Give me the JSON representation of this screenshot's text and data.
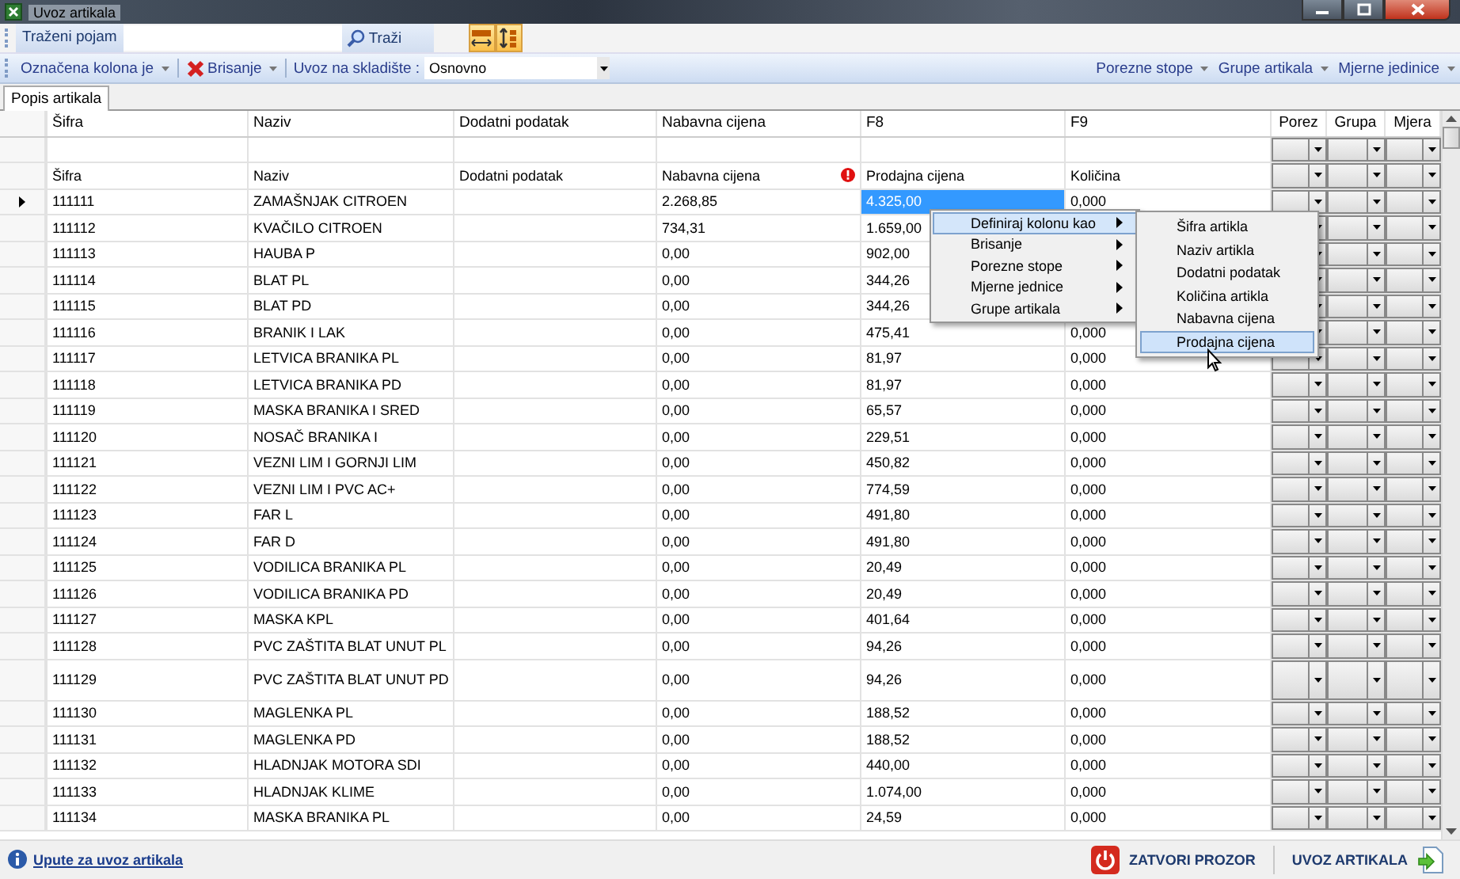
{
  "window": {
    "title": "Uvoz artikala"
  },
  "search_bar": {
    "label": "Traženi pojam",
    "button": "Traži"
  },
  "toolbar": {
    "left": [
      {
        "label": "Označena kolona je",
        "kind": "menu"
      },
      {
        "label": "Brisanje",
        "kind": "delete"
      }
    ],
    "warehouse_label": "Uvoz na skladište :",
    "warehouse_value": "Osnovno",
    "right": [
      "Porezne stope",
      "Grupe artikala",
      "Mjerne jedinice"
    ]
  },
  "tabs": [
    {
      "label": "Popis artikala",
      "selected": true
    }
  ],
  "table": {
    "columns": [
      "Šifra",
      "Naziv",
      "Dodatni podatak",
      "Nabavna cijena",
      "F8",
      "F9",
      "Porez",
      "Grupa",
      "Mjera"
    ],
    "mapping": [
      {
        "label": "Šifra",
        "error": false
      },
      {
        "label": "Naziv",
        "error": false
      },
      {
        "label": "Dodatni podatak",
        "error": false
      },
      {
        "label": "Nabavna cijena",
        "error": true
      },
      {
        "label": "Prodajna cijena",
        "error": false
      },
      {
        "label": "Količina",
        "error": false
      }
    ],
    "rows": [
      {
        "sifra": "111111",
        "naziv": "ZAMAŠNJAK CITROEN",
        "nabavna": "2.268,85",
        "prodajna": "4.325,00",
        "kolicina": "0,000",
        "selected": true
      },
      {
        "sifra": "111112",
        "naziv": "KVAČILO CITROEN",
        "nabavna": "734,31",
        "prodajna": "1.659,00",
        "selected": false
      },
      {
        "sifra": "111113",
        "naziv": "HAUBA P",
        "nabavna": "0,00",
        "prodajna": "902,00",
        "selected": false
      },
      {
        "sifra": "111114",
        "naziv": "BLAT PL",
        "nabavna": "0,00",
        "prodajna": "344,26",
        "selected": false
      },
      {
        "sifra": "111115",
        "naziv": "BLAT PD",
        "nabavna": "0,00",
        "prodajna": "344,26",
        "selected": false
      },
      {
        "sifra": "111116",
        "naziv": "BRANIK I LAK",
        "nabavna": "0,00",
        "prodajna": "475,41",
        "kolicina": "0,000",
        "selected": false
      },
      {
        "sifra": "111117",
        "naziv": "LETVICA BRANIKA PL",
        "nabavna": "0,00",
        "prodajna": "81,97",
        "kolicina": "0,000",
        "selected": false
      },
      {
        "sifra": "111118",
        "naziv": "LETVICA BRANIKA PD",
        "nabavna": "0,00",
        "prodajna": "81,97",
        "kolicina": "0,000",
        "selected": false
      },
      {
        "sifra": "111119",
        "naziv": "MASKA BRANIKA I SRED",
        "nabavna": "0,00",
        "prodajna": "65,57",
        "kolicina": "0,000",
        "selected": false
      },
      {
        "sifra": "111120",
        "naziv": "NOSAČ BRANIKA I",
        "nabavna": "0,00",
        "prodajna": "229,51",
        "kolicina": "0,000",
        "selected": false
      },
      {
        "sifra": "111121",
        "naziv": "VEZNI LIM I GORNJI LIM",
        "nabavna": "0,00",
        "prodajna": "450,82",
        "kolicina": "0,000",
        "selected": false
      },
      {
        "sifra": "111122",
        "naziv": "VEZNI LIM I PVC AC+",
        "nabavna": "0,00",
        "prodajna": "774,59",
        "kolicina": "0,000",
        "selected": false
      },
      {
        "sifra": "111123",
        "naziv": "FAR L",
        "nabavna": "0,00",
        "prodajna": "491,80",
        "kolicina": "0,000",
        "selected": false
      },
      {
        "sifra": "111124",
        "naziv": "FAR D",
        "nabavna": "0,00",
        "prodajna": "491,80",
        "kolicina": "0,000",
        "selected": false
      },
      {
        "sifra": "111125",
        "naziv": "VODILICA BRANIKA PL",
        "nabavna": "0,00",
        "prodajna": "20,49",
        "kolicina": "0,000",
        "selected": false
      },
      {
        "sifra": "111126",
        "naziv": "VODILICA BRANIKA PD",
        "nabavna": "0,00",
        "prodajna": "20,49",
        "kolicina": "0,000",
        "selected": false
      },
      {
        "sifra": "111127",
        "naziv": "MASKA KPL",
        "nabavna": "0,00",
        "prodajna": "401,64",
        "kolicina": "0,000",
        "selected": false
      },
      {
        "sifra": "111128",
        "naziv": "PVC ZAŠTITA BLAT UNUT PL",
        "nabavna": "0,00",
        "prodajna": "94,26",
        "kolicina": "0,000",
        "selected": false
      },
      {
        "sifra": "111129",
        "naziv": "PVC ZAŠTITA BLAT UNUT PD",
        "nabavna": "0,00",
        "prodajna": "94,26",
        "kolicina": "0,000",
        "selected": false
      },
      {
        "sifra": "111130",
        "naziv": "MAGLENKA PL",
        "nabavna": "0,00",
        "prodajna": "188,52",
        "kolicina": "0,000",
        "selected": false
      },
      {
        "sifra": "111131",
        "naziv": "MAGLENKA PD",
        "nabavna": "0,00",
        "prodajna": "188,52",
        "kolicina": "0,000",
        "selected": false
      },
      {
        "sifra": "111132",
        "naziv": "HLADNJAK MOTORA SDI",
        "nabavna": "0,00",
        "prodajna": "440,00",
        "kolicina": "0,000",
        "selected": false
      },
      {
        "sifra": "111133",
        "naziv": "HLADNJAK KLIME",
        "nabavna": "0,00",
        "prodajna": "1.074,00",
        "kolicina": "0,000",
        "selected": false
      },
      {
        "sifra": "111134",
        "naziv": "MASKA BRANIKA PL",
        "nabavna": "0,00",
        "prodajna": "24,59",
        "kolicina": "0,000",
        "selected": false
      }
    ]
  },
  "context_menu": {
    "items": [
      {
        "label": "Definiraj kolonu kao",
        "selected": true
      },
      {
        "label": "Brisanje",
        "selected": false
      },
      {
        "label": "Porezne stope",
        "selected": false
      },
      {
        "label": "Mjerne jednice",
        "selected": false
      },
      {
        "label": "Grupe artikala",
        "selected": false
      }
    ],
    "submenu": [
      {
        "label": "Šifra artikla",
        "selected": false
      },
      {
        "label": "Naziv artikla",
        "selected": false
      },
      {
        "label": "Dodatni podatak",
        "selected": false
      },
      {
        "label": "Količina artikla",
        "selected": false
      },
      {
        "label": "Nabavna cijena",
        "selected": false
      },
      {
        "label": "Prodajna cijena",
        "selected": true
      }
    ]
  },
  "footer": {
    "help_link": "Upute za uvoz artikala",
    "buttons": [
      {
        "label": "ZATVORI PROZOR",
        "kind": "close"
      },
      {
        "label": "UVOZ ARTIKALA",
        "kind": "import"
      }
    ]
  }
}
